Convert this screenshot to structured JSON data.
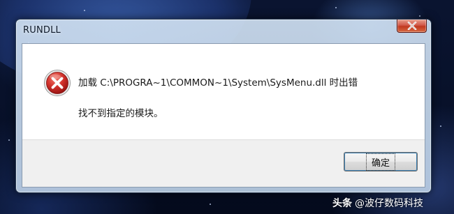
{
  "window": {
    "title": "RUNDLL",
    "close_icon": "close-icon"
  },
  "dialog": {
    "icon": "error-icon",
    "message_line1": "加载 C:\\PROGRA~1\\COMMON~1\\System\\SysMenu.dll 时出错",
    "message_line2": "找不到指定的模块。",
    "ok_label": "确定"
  },
  "watermark": {
    "brand": "头条",
    "author": "@波仔数码科技"
  },
  "colors": {
    "close_button": "#c1381f",
    "error_icon": "#c8231f",
    "footer_bg": "#f0f0f0",
    "focus_ring": "#3c7fb1"
  }
}
